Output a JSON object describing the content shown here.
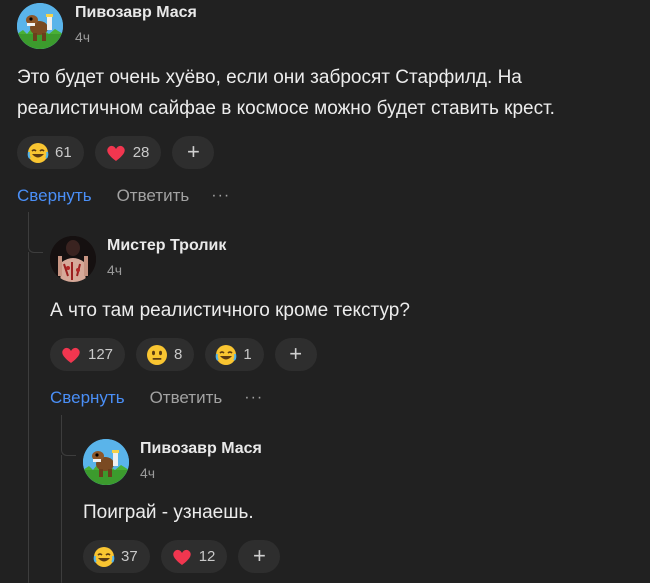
{
  "comments": [
    {
      "author": "Пивозавр Мася",
      "time": "4ч",
      "text_lines": [
        "Это будет очень хуёво, если они забросят Старфилд. На",
        "реалистичном сайфае в космосе можно будет ставить крест."
      ],
      "reactions": [
        {
          "icon": "laughing-emoji",
          "count": "61"
        },
        {
          "icon": "heart-emoji",
          "count": "28"
        }
      ],
      "actions": {
        "collapse": "Свернуть",
        "reply": "Ответить",
        "more": "···"
      }
    },
    {
      "author": "Мистер Тролик",
      "time": "4ч",
      "text_lines": [
        "А что там реалистичного кроме текстур?"
      ],
      "reactions": [
        {
          "icon": "heart-emoji",
          "count": "127"
        },
        {
          "icon": "neutral-face-emoji",
          "count": "8"
        },
        {
          "icon": "laughing-emoji",
          "count": "1"
        }
      ],
      "actions": {
        "collapse": "Свернуть",
        "reply": "Ответить",
        "more": "···"
      }
    },
    {
      "author": "Пивозавр Мася",
      "time": "4ч",
      "text_lines": [
        "Поиграй - узнаешь."
      ],
      "reactions": [
        {
          "icon": "laughing-emoji",
          "count": "37"
        },
        {
          "icon": "heart-emoji",
          "count": "12"
        }
      ]
    }
  ],
  "add_reaction_label": "+",
  "colors": {
    "background": "#212121",
    "link": "#4a8ff7",
    "pill": "#2e2e2e"
  }
}
